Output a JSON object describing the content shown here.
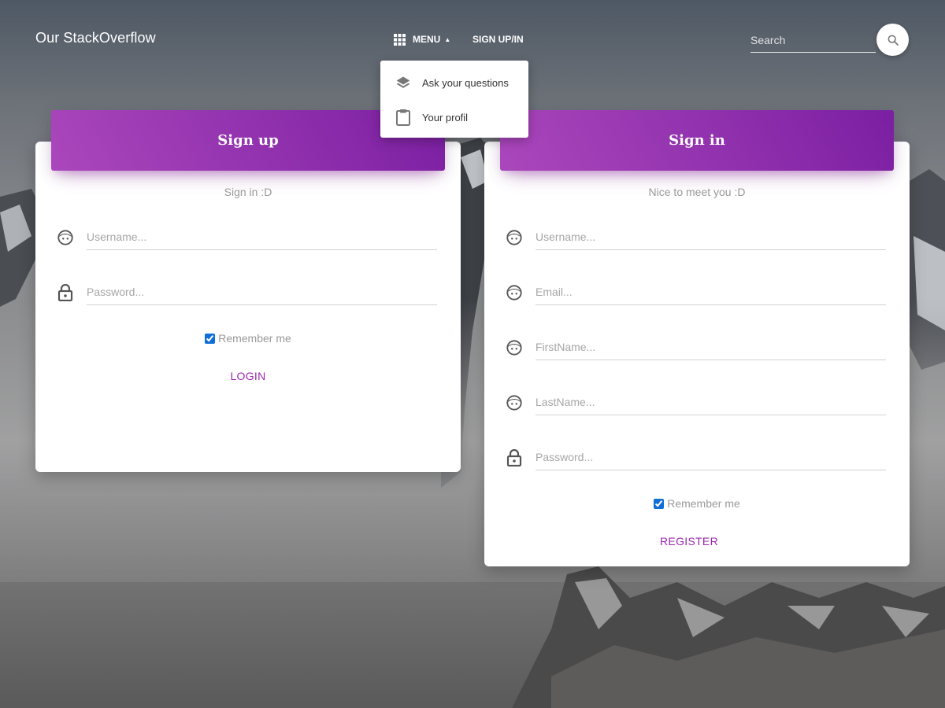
{
  "navbar": {
    "brand": "Our StackOverflow",
    "menu_label": "MENU",
    "signup_link": "SIGN UP/IN",
    "search_placeholder": "Search"
  },
  "dropdown": {
    "items": [
      {
        "label": "Ask your questions",
        "icon": "layers-icon"
      },
      {
        "label": "Your profil",
        "icon": "clipboard-icon"
      }
    ]
  },
  "signin_card": {
    "title": "Sign up",
    "subtitle": "Sign in :D",
    "username_placeholder": "Username...",
    "password_placeholder": "Password...",
    "remember_label": "Remember me",
    "remember_checked": true,
    "action_label": "LOGIN"
  },
  "register_card": {
    "title": "Sign in",
    "subtitle": "Nice to meet you :D",
    "username_placeholder": "Username...",
    "email_placeholder": "Email...",
    "firstname_placeholder": "FirstName...",
    "lastname_placeholder": "LastName...",
    "password_placeholder": "Password...",
    "remember_label": "Remember me",
    "remember_checked": true,
    "action_label": "REGISTER"
  },
  "colors": {
    "accent": "#9c27b0",
    "header_gradient_start": "#ab47bc",
    "header_gradient_end": "#7b1fa2"
  }
}
